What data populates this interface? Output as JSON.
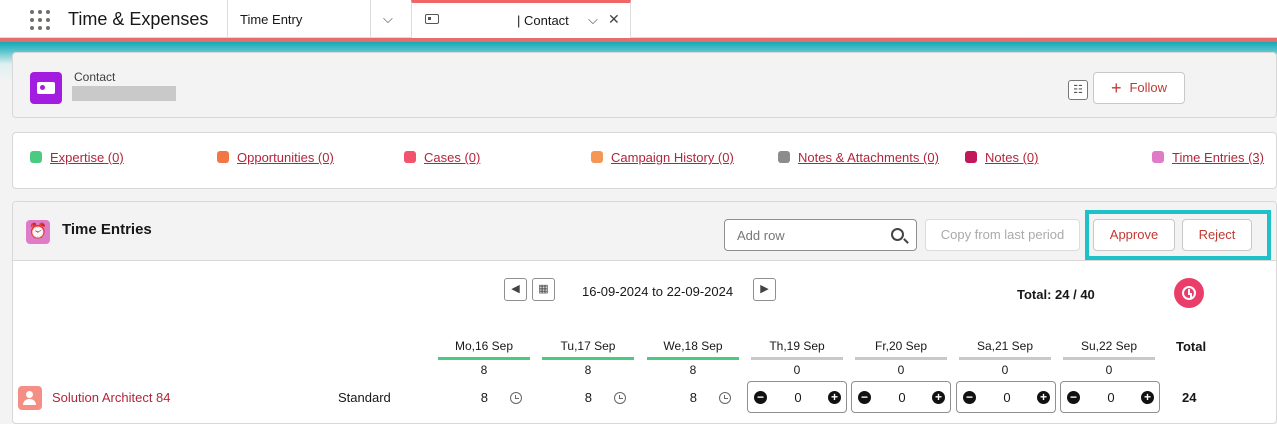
{
  "app": {
    "name": "Time & Expenses"
  },
  "tabs": [
    {
      "label": "Time Entry"
    },
    {
      "label": "| Contact"
    }
  ],
  "record": {
    "type": "Contact",
    "follow_label": "Follow"
  },
  "related_links": [
    {
      "label": "Expertise (0)",
      "color": "#4bca81"
    },
    {
      "label": "Opportunities (0)",
      "color": "#fcb95b"
    },
    {
      "label": "Cases (0)",
      "color": "#f2536d"
    },
    {
      "label": "Campaign History (0)",
      "color": "#f49756"
    },
    {
      "label": "Notes & Attachments (0)",
      "color": "#8c8c8c"
    },
    {
      "label": "Notes (0)",
      "color": "#c2185b"
    },
    {
      "label": "Time Entries (3)",
      "color": "#e07bc7"
    }
  ],
  "time_entries": {
    "title": "Time Entries",
    "add_row_placeholder": "Add row",
    "copy_label": "Copy from last period",
    "approve_label": "Approve",
    "reject_label": "Reject",
    "period": "16-09-2024 to 22-09-2024",
    "total_label": "Total: 24 / 40",
    "total_header": "Total",
    "days": [
      {
        "label": "Mo,16 Sep",
        "total": "8",
        "status": "green"
      },
      {
        "label": "Tu,17 Sep",
        "total": "8",
        "status": "green"
      },
      {
        "label": "We,18 Sep",
        "total": "8",
        "status": "green"
      },
      {
        "label": "Th,19 Sep",
        "total": "0",
        "status": "gray"
      },
      {
        "label": "Fr,20 Sep",
        "total": "0",
        "status": "gray"
      },
      {
        "label": "Sa,21 Sep",
        "total": "0",
        "status": "gray"
      },
      {
        "label": "Su,22 Sep",
        "total": "0",
        "status": "gray"
      }
    ],
    "rows": [
      {
        "name": "Solution Architect 84",
        "type": "Standard",
        "values": [
          "8",
          "8",
          "8",
          "0",
          "0",
          "0",
          "0"
        ],
        "total": "24"
      }
    ]
  },
  "colors": {
    "accent": "#c23934",
    "highlight": "#1ec1c8",
    "green": "#4bca81",
    "gray": "#c9c9c9"
  }
}
